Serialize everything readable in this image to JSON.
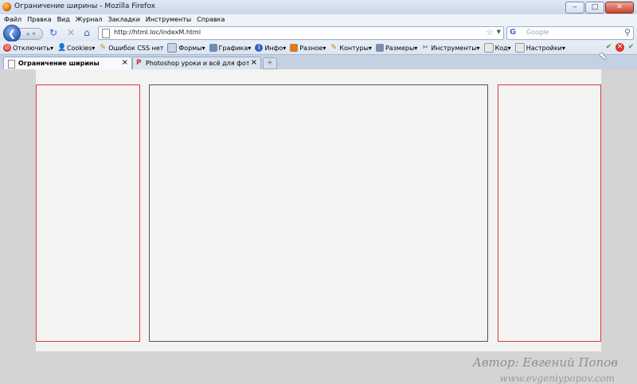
{
  "window": {
    "title": "Ограничение ширины - Mozilla Firefox",
    "minimize": "‒",
    "maximize": "□",
    "close": "✕"
  },
  "menu": [
    "Файл",
    "Правка",
    "Вид",
    "Журнал",
    "Закладки",
    "Инструменты",
    "Справка"
  ],
  "nav": {
    "url": "http://html.loc/indexM.html",
    "search_placeholder": "Google",
    "search_engine": "G"
  },
  "devtoolbar": {
    "items": [
      {
        "label": "Отключить",
        "icon": "disable-icon"
      },
      {
        "label": "Cookies",
        "icon": "person-icon"
      },
      {
        "label": "Ошибок CSS нет",
        "icon": "pencil-icon"
      },
      {
        "label": "Формы",
        "icon": "form-icon"
      },
      {
        "label": "Графика",
        "icon": "image-icon"
      },
      {
        "label": "Инфо",
        "icon": "info-icon"
      },
      {
        "label": "Разное",
        "icon": "misc-icon"
      },
      {
        "label": "Контуры",
        "icon": "outline-icon"
      },
      {
        "label": "Размеры",
        "icon": "size-icon"
      },
      {
        "label": "Инструменты",
        "icon": "tools-icon"
      },
      {
        "label": "Код",
        "icon": "code-icon"
      },
      {
        "label": "Настройки",
        "icon": "settings-icon"
      }
    ]
  },
  "tabs": [
    {
      "label": "Ограничение ширины",
      "active": true
    },
    {
      "label": "Photoshop уроки и всё для фотош...",
      "active": false
    }
  ],
  "watermark": {
    "line1": "Автор: Евгений Попов",
    "line2": "www.evgeniypopov.com"
  },
  "colors": {
    "column_side_border": "#d83a3a",
    "column_center_border": "#555555",
    "page_background": "#d4d4d4",
    "wrapper_background": "#f3f3f2"
  }
}
